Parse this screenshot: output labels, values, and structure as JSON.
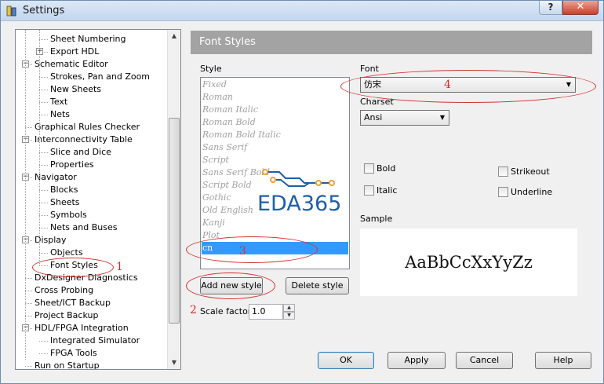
{
  "window": {
    "title": "Settings",
    "help_btn": "?",
    "close_btn": "✕"
  },
  "tree": {
    "items": [
      {
        "label": "Sheet Numbering",
        "level": 2,
        "expander": ""
      },
      {
        "label": "Export HDL",
        "level": 2,
        "expander": "+"
      },
      {
        "label": "Schematic Editor",
        "level": 1,
        "expander": "−"
      },
      {
        "label": "Strokes, Pan and Zoom",
        "level": 2,
        "expander": ""
      },
      {
        "label": "New Sheets",
        "level": 2,
        "expander": ""
      },
      {
        "label": "Text",
        "level": 2,
        "expander": ""
      },
      {
        "label": "Nets",
        "level": 2,
        "expander": ""
      },
      {
        "label": "Graphical Rules Checker",
        "level": 1,
        "expander": ""
      },
      {
        "label": "Interconnectivity Table",
        "level": 1,
        "expander": "−"
      },
      {
        "label": "Slice and Dice",
        "level": 2,
        "expander": ""
      },
      {
        "label": "Properties",
        "level": 2,
        "expander": ""
      },
      {
        "label": "Navigator",
        "level": 1,
        "expander": "−"
      },
      {
        "label": "Blocks",
        "level": 2,
        "expander": ""
      },
      {
        "label": "Sheets",
        "level": 2,
        "expander": ""
      },
      {
        "label": "Symbols",
        "level": 2,
        "expander": ""
      },
      {
        "label": "Nets and Buses",
        "level": 2,
        "expander": ""
      },
      {
        "label": "Display",
        "level": 1,
        "expander": "−"
      },
      {
        "label": "Objects",
        "level": 2,
        "expander": ""
      },
      {
        "label": "Font Styles",
        "level": 2,
        "expander": ""
      },
      {
        "label": "DxDesigner Diagnostics",
        "level": 1,
        "expander": ""
      },
      {
        "label": "Cross Probing",
        "level": 1,
        "expander": ""
      },
      {
        "label": "Sheet/ICT Backup",
        "level": 1,
        "expander": ""
      },
      {
        "label": "Project Backup",
        "level": 1,
        "expander": ""
      },
      {
        "label": "HDL/FPGA Integration",
        "level": 1,
        "expander": "−"
      },
      {
        "label": "Integrated Simulator",
        "level": 2,
        "expander": ""
      },
      {
        "label": "FPGA Tools",
        "level": 2,
        "expander": ""
      },
      {
        "label": "Run on Startup",
        "level": 1,
        "expander": ""
      }
    ]
  },
  "panel": {
    "title": "Font Styles",
    "style_label": "Style",
    "styles": [
      "Fixed",
      "Roman",
      "Roman Italic",
      "Roman Bold",
      "Roman Bold Italic",
      "Sans Serif",
      "Script",
      "Sans Serif Bold",
      "Script Bold",
      "Gothic",
      "Old English",
      "Kanji",
      "Plot",
      "cn"
    ],
    "selected_style": "cn",
    "add_style": "Add new style",
    "delete_style": "Delete style",
    "scale_label": "Scale factor",
    "scale_value": "1.0",
    "font_label": "Font",
    "font_value": "仿宋",
    "charset_label": "Charset",
    "charset_value": "Ansi",
    "bold": "Bold",
    "italic": "Italic",
    "strikeout": "Strikeout",
    "underline": "Underline",
    "sample_label": "Sample",
    "sample_text": "AaBbCcXxYyZz"
  },
  "buttons": {
    "ok": "OK",
    "apply": "Apply",
    "cancel": "Cancel",
    "help": "Help"
  },
  "annotations": {
    "n1": "1",
    "n2": "2",
    "n3": "3",
    "n4": "4"
  },
  "watermark": {
    "text": "EDA365"
  },
  "colors": {
    "selection": "#3399ff",
    "header_bg": "#a3a3a3",
    "annotation": "#d62b2b",
    "watermark_blue": "#1f5fa8",
    "watermark_orange": "#f0a030"
  }
}
